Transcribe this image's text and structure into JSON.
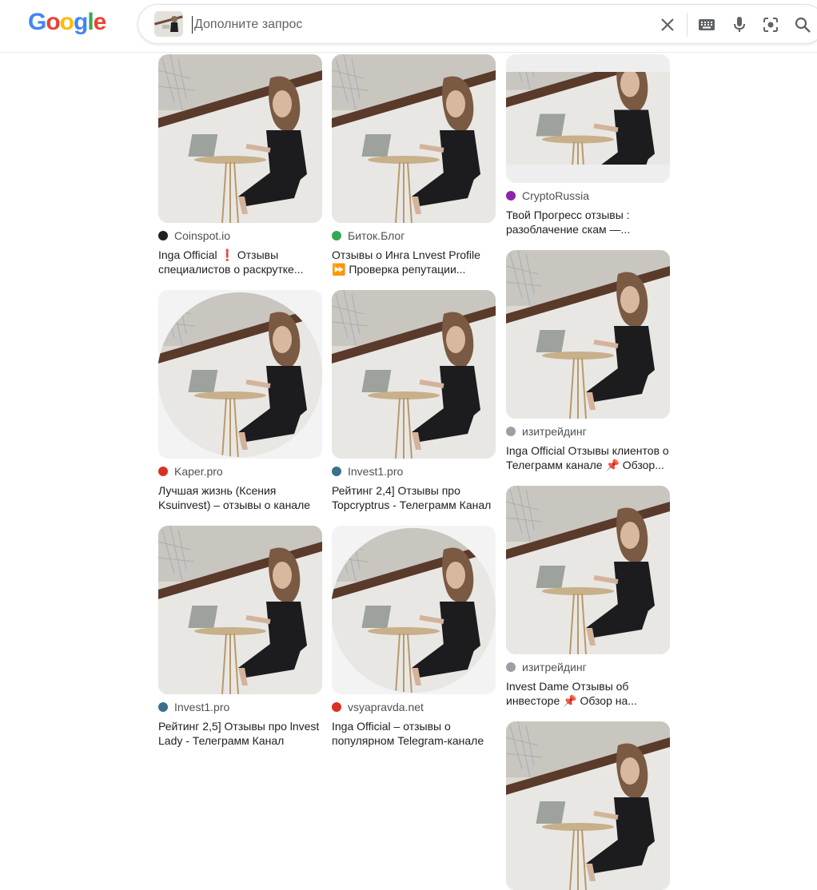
{
  "header": {
    "logo_text": "Google",
    "search_placeholder": "Дополните запрос",
    "icons": [
      "close-icon",
      "keyboard-icon",
      "microphone-icon",
      "lens-icon",
      "search-icon"
    ]
  },
  "results": [
    {
      "source": "Coinspot.io",
      "title": "Inga Official ❗ Отзывы специалистов о раскрутке...",
      "favicon_color": "#202124",
      "shape": "rect"
    },
    {
      "source": "Биток.Блог",
      "title": "Отзывы о Инга Lnvest Profile ⏩ Проверка репутации...",
      "favicon_color": "#34a853",
      "shape": "rect"
    },
    {
      "source": "CryptoRussia",
      "title": "Твой Прогресс отзывы : разоблачение скам —...",
      "favicon_color": "#8e24aa",
      "shape": "short"
    },
    {
      "source": "Kaper.pro",
      "title": "Лучшая жизнь (Ксения Ksuinvest) – отзывы о канале",
      "favicon_color": "#d93025",
      "shape": "circle"
    },
    {
      "source": "Invest1.pro",
      "title": "Рейтинг 2,4] Отзывы про Topcryptrus - Телеграмм Канал",
      "favicon_color": "#3c6e8f",
      "shape": "rect"
    },
    {
      "source": "изитрейдинг",
      "title": "Inga Official Отзывы клиентов о Телеграмм канале 📌 Обзор...",
      "favicon_color": "#9aa0a6",
      "shape": "rect"
    },
    {
      "source": "Invest1.pro",
      "title": "Рейтинг 2,5] Отзывы про lnvest Lady - Телеграмм Канал",
      "favicon_color": "#3c6e8f",
      "shape": "rect"
    },
    {
      "source": "vsyapravda.net",
      "title": "Inga Official – отзывы о популярном Telegram-канале",
      "favicon_color": "#d93025",
      "shape": "circle"
    },
    {
      "source": "изитрейдинг",
      "title": "Invest Dame Отзывы об инвесторе 📌 Обзор на...",
      "favicon_color": "#9aa0a6",
      "shape": "rect"
    },
    {
      "source": "",
      "title": "",
      "favicon_color": "#ffffff",
      "shape": "rect"
    }
  ]
}
